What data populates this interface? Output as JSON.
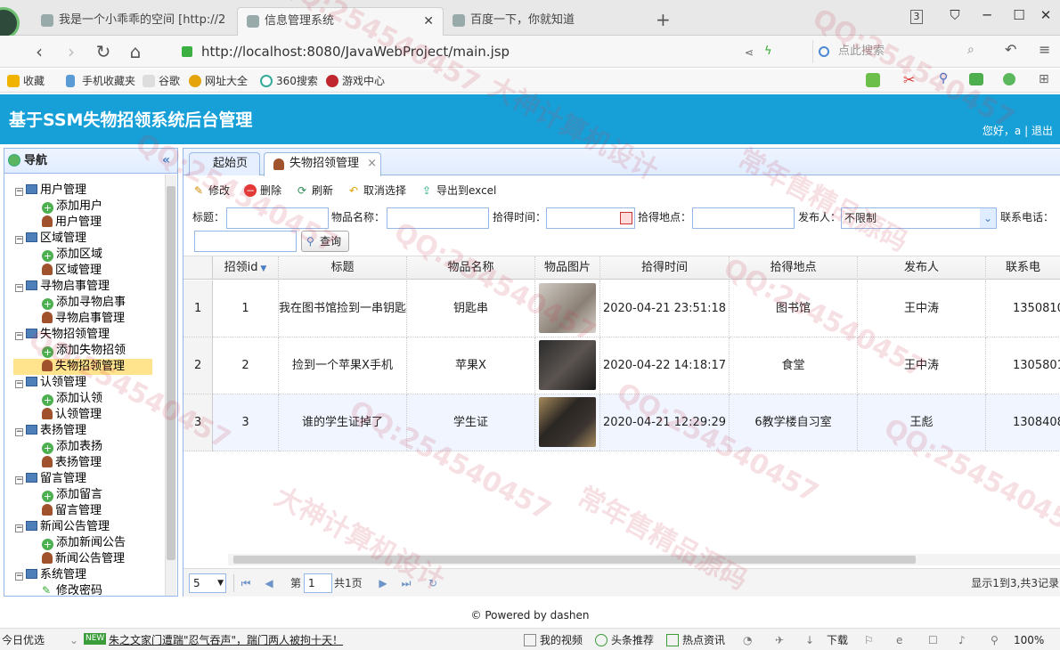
{
  "browser": {
    "tabs": [
      {
        "title": "我是一个小乖乖的空间 [http://2"
      },
      {
        "title": "信息管理系统"
      },
      {
        "title": "百度一下，你就知道"
      }
    ],
    "new_tab_symbol": "+",
    "url": "http://localhost:8080/JavaWebProject/main.jsp",
    "search_placeholder": "点此搜索",
    "tab_count": "3"
  },
  "bookmarks": [
    "收藏",
    "手机收藏夹",
    "谷歌",
    "网址大全",
    "360搜索",
    "游戏中心"
  ],
  "app": {
    "title": "基于SSM失物招领系统后台管理",
    "greeting": "您好，a",
    "separator": "|",
    "logout": "退出"
  },
  "sidebar": {
    "title": "导航",
    "groups": [
      {
        "label": "用户管理",
        "items": [
          "添加用户",
          "用户管理"
        ]
      },
      {
        "label": "区域管理",
        "items": [
          "添加区域",
          "区域管理"
        ]
      },
      {
        "label": "寻物启事管理",
        "items": [
          "添加寻物启事",
          "寻物启事管理"
        ]
      },
      {
        "label": "失物招领管理",
        "items": [
          "添加失物招领",
          "失物招领管理"
        ]
      },
      {
        "label": "认领管理",
        "items": [
          "添加认领",
          "认领管理"
        ]
      },
      {
        "label": "表扬管理",
        "items": [
          "添加表扬",
          "表扬管理"
        ]
      },
      {
        "label": "留言管理",
        "items": [
          "添加留言",
          "留言管理"
        ]
      },
      {
        "label": "新闻公告管理",
        "items": [
          "添加新闻公告",
          "新闻公告管理"
        ]
      },
      {
        "label": "系统管理",
        "items": [
          "修改密码"
        ]
      }
    ]
  },
  "panel_tabs": {
    "home": "起始页",
    "current": "失物招领管理",
    "close": "×"
  },
  "toolbar": {
    "edit": "修改",
    "delete": "删除",
    "refresh": "刷新",
    "unselect": "取消选择",
    "export": "导出到excel"
  },
  "filters": {
    "title_label": "标题：",
    "item_label": "物品名称：",
    "time_label": "拾得时间：",
    "place_label": "拾得地点：",
    "publisher_label": "发布人：",
    "publisher_value": "不限制",
    "phone_label": "联系电话：",
    "query_button": "查询"
  },
  "grid": {
    "headers": [
      "招领id",
      "标题",
      "物品名称",
      "物品图片",
      "拾得时间",
      "拾得地点",
      "发布人",
      "联系电"
    ],
    "rows": [
      {
        "n": "1",
        "id": "1",
        "title": "我在图书馆捡到一串钥匙",
        "item": "钥匙串",
        "time": "2020-04-21 23:51:18",
        "place": "图书馆",
        "publisher": "王中涛",
        "phone": "1350810"
      },
      {
        "n": "2",
        "id": "2",
        "title": "捡到一个苹果X手机",
        "item": "苹果X",
        "time": "2020-04-22 14:18:17",
        "place": "食堂",
        "publisher": "王中涛",
        "phone": "1305801"
      },
      {
        "n": "3",
        "id": "3",
        "title": "谁的学生证掉了",
        "item": "学生证",
        "time": "2020-04-21 12:29:29",
        "place": "6教学楼自习室",
        "publisher": "王彪",
        "phone": "1308408"
      }
    ]
  },
  "pager": {
    "page_size": "5",
    "page_prefix": "第",
    "page_value": "1",
    "page_total": "共1页",
    "summary": "显示1到3,共3记录"
  },
  "footer": "© Powered by dashen",
  "statusbar": {
    "left": "今日优选",
    "news_badge": "NEW",
    "news": "朱之文家门遭踹\"忍气吞声\"，踹门两人被拘十天！",
    "video": "我的视频",
    "headline": "头条推荐",
    "hot": "热点资讯",
    "download": "下载",
    "zoom": "100%"
  },
  "watermarks": [
    "QQ:254540457",
    "大神计算机设计",
    "常年售精品源码"
  ],
  "colors": {
    "header": "#17a0d8",
    "border": "#95b8e7",
    "selected": "#ffe48d"
  }
}
